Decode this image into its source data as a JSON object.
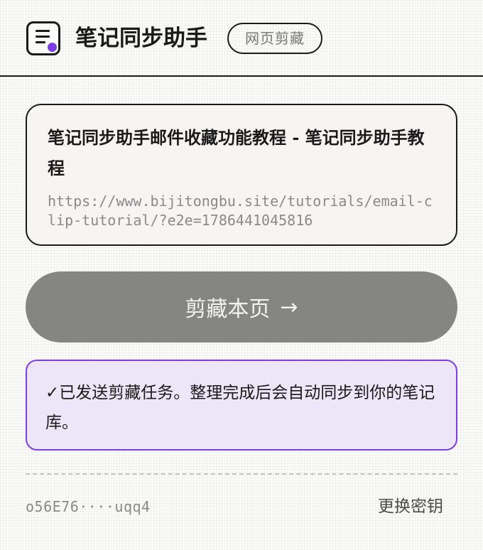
{
  "app": {
    "title": "笔记同步助手",
    "mode_badge": "网页剪藏",
    "accent_color": "#7b3fe4",
    "logo_icon": "note-list-icon"
  },
  "page": {
    "title": "笔记同步助手邮件收藏功能教程 - 笔记同步助手教程",
    "url": "https://www.bijitongbu.site/tutorials/email-clip-tutorial/?e2e=1786441045816"
  },
  "clip_button": {
    "label": "剪藏本页",
    "arrow": "→",
    "arrow_icon": "arrow-right-icon"
  },
  "status": {
    "check": "✓",
    "message": "已发送剪藏任务。整理完成后会自动同步到你的笔记库。",
    "color": "#7b3fe4"
  },
  "footer": {
    "key_masked": "o56E76····uqq4",
    "change_key_label": "更换密钥"
  }
}
